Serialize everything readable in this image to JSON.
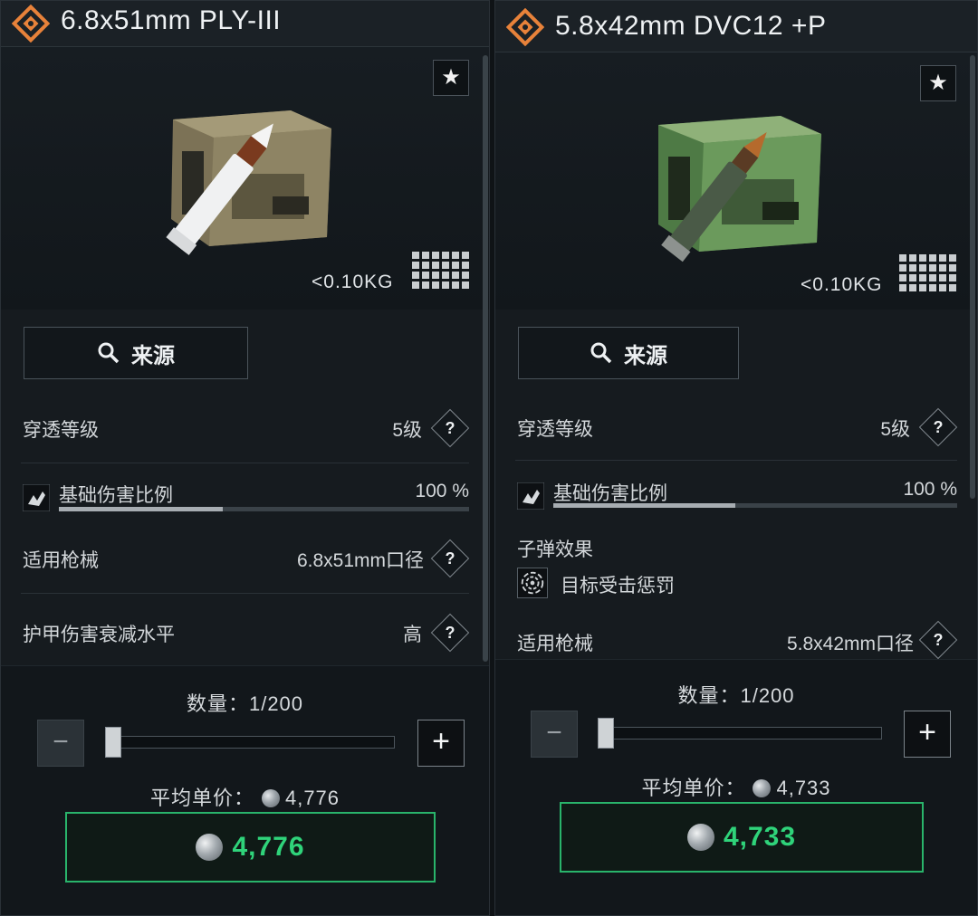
{
  "left": {
    "title": "6.8x51mm PLY-III",
    "weight": "<0.10KG",
    "source_label": "来源",
    "stats": {
      "penetration_label": "穿透等级",
      "penetration_value": "5级",
      "damage_label": "基础伤害比例",
      "damage_value": "100 %",
      "damage_fraction": 0.4,
      "weapon_label": "适用枪械",
      "weapon_value": "6.8x51mm口径",
      "armor_label": "护甲伤害衰减水平",
      "armor_value": "高"
    },
    "help": "?",
    "quantity_label": "数量：1/200",
    "minus": "−",
    "plus": "+",
    "avg_price_label": "平均单价：",
    "avg_price_value": "4,776",
    "buy_price": "4,776"
  },
  "right": {
    "title": "5.8x42mm DVC12 +P",
    "weight": "<0.10KG",
    "source_label": "来源",
    "stats": {
      "penetration_label": "穿透等级",
      "penetration_value": "5级",
      "damage_label": "基础伤害比例",
      "damage_value": "100 %",
      "damage_fraction": 0.45,
      "effect_label": "子弹效果",
      "effect_value": "目标受击惩罚",
      "weapon_label": "适用枪械",
      "weapon_value": "5.8x42mm口径"
    },
    "help": "?",
    "quantity_label": "数量：1/200",
    "minus": "−",
    "plus": "+",
    "avg_price_label": "平均单价：",
    "avg_price_value": "4,733",
    "buy_price": "4,733"
  },
  "icons": {
    "logo": "orange-diamond-logo-icon",
    "star": "star-icon",
    "search": "search-icon",
    "grid": "size-grid-icon",
    "damage": "damage-icon",
    "effect": "spiral-effect-icon",
    "coin": "coin-icon"
  },
  "colors": {
    "accent_orange": "#e8823a",
    "buy_green": "#2fd37a",
    "buy_border": "#29b46b",
    "background": "#161b1f"
  }
}
